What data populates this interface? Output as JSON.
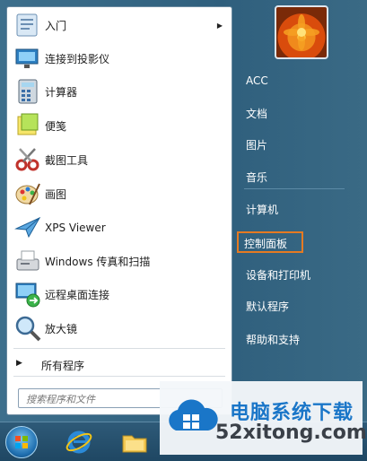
{
  "start_menu": {
    "programs": [
      {
        "label": "入门",
        "icon": "getting-started-icon",
        "has_submenu": true
      },
      {
        "label": "连接到投影仪",
        "icon": "projector-icon"
      },
      {
        "label": "计算器",
        "icon": "calculator-icon"
      },
      {
        "label": "便笺",
        "icon": "sticky-notes-icon"
      },
      {
        "label": "截图工具",
        "icon": "snipping-tool-icon"
      },
      {
        "label": "画图",
        "icon": "paint-icon"
      },
      {
        "label": "XPS Viewer",
        "icon": "xps-viewer-icon"
      },
      {
        "label": "Windows 传真和扫描",
        "icon": "fax-scan-icon"
      },
      {
        "label": "远程桌面连接",
        "icon": "remote-desktop-icon"
      },
      {
        "label": "放大镜",
        "icon": "magnifier-icon"
      }
    ],
    "all_programs_label": "所有程序",
    "search_placeholder": "搜索程序和文件",
    "right_items": [
      {
        "label": "ACC"
      },
      {
        "label": "文档"
      },
      {
        "label": "图片"
      },
      {
        "label": "音乐"
      },
      {
        "label": "计算机"
      },
      {
        "label": "控制面板",
        "highlighted": true
      },
      {
        "label": "设备和打印机"
      },
      {
        "label": "默认程序"
      },
      {
        "label": "帮助和支持"
      }
    ],
    "highlight_color": "#e57a22"
  },
  "watermark": {
    "title": "电脑系统下载",
    "url": "52xitong.com"
  }
}
